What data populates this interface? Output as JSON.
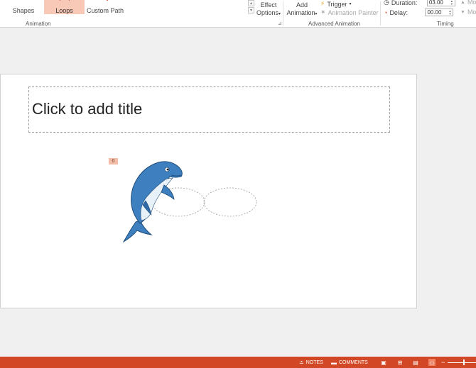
{
  "ribbon": {
    "motion_gallery": {
      "items": [
        {
          "label": "Shapes",
          "selected": false,
          "icon": "shapes-icon"
        },
        {
          "label": "Loops",
          "selected": true,
          "icon": "loops-icon"
        },
        {
          "label": "Custom Path",
          "selected": false,
          "icon": "custom-path-icon"
        }
      ]
    },
    "effect_options": {
      "line1": "Effect",
      "line2": "Options",
      "arrow": "▾"
    },
    "add_animation": {
      "line1": "Add",
      "line2": "Animation",
      "arrow": "▾"
    },
    "trigger": {
      "label": "Trigger",
      "arrow": "▾"
    },
    "animation_painter": {
      "label": "Animation Painter"
    },
    "duration": {
      "label": "Duration:",
      "value": "03.00"
    },
    "delay": {
      "label": "Delay:",
      "value": "00.00"
    },
    "move_earlier": {
      "label": "Mo"
    },
    "move_later": {
      "label": "Mo"
    },
    "groups": {
      "animation": "Animation",
      "advanced_animation": "Advanced Animation",
      "timing": "Timing"
    }
  },
  "slide": {
    "title_placeholder": "Click to add title",
    "animation_tag": "0"
  },
  "status_bar": {
    "notes": "NOTES",
    "comments": "COMMENTS",
    "view_active": "slide-show"
  },
  "colors": {
    "accent": "#d24726",
    "selected_item": "#f9c9b7",
    "animation_tag": "#f3bda8",
    "dolphin_body": "#3e7fbf",
    "dolphin_belly": "#e8f1f8"
  }
}
